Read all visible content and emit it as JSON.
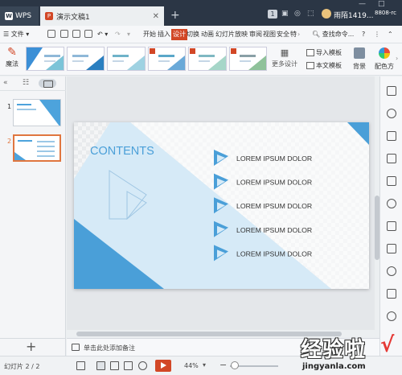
{
  "titlebar": {
    "app_name": "WPS",
    "doc_tab": "演示文稿1",
    "add_tab": "+",
    "window_badge": "1",
    "user_name": "雨陌1419...",
    "user_id": "8808-rc"
  },
  "menubar": {
    "file": "文件",
    "items": [
      "开始",
      "插入",
      "设计",
      "切换",
      "动画",
      "幻灯片放映",
      "审阅",
      "视图",
      "安全",
      "特"
    ],
    "active": "设计",
    "search": "查找命令..."
  },
  "ribbon": {
    "magic": "魔法",
    "more_design": "更多设计",
    "import_template": "导入模板",
    "text_template": "本文模板",
    "background": "背景",
    "color_scheme": "配色方"
  },
  "slides_panel": {
    "thumbnails": [
      {
        "number": "1"
      },
      {
        "number": "2"
      }
    ]
  },
  "slide": {
    "heading": "CONTENTS",
    "items": [
      "LOREM IPSUM DOLOR",
      "LOREM IPSUM DOLOR",
      "LOREM IPSUM DOLOR",
      "LOREM IPSUM DOLOR",
      "LOREM IPSUM DOLOR"
    ],
    "accent_color": "#4a9fd8",
    "light_color": "#d6eaf7"
  },
  "notes": {
    "placeholder": "单击此处添加备注"
  },
  "status": {
    "slide_count": "幻灯片 2 / 2",
    "zoom": "44%",
    "zoom_out": "−",
    "zoom_percent": 0.44
  },
  "watermark": {
    "title": "经验啦",
    "check": "√",
    "url": "jingyanla.com"
  }
}
